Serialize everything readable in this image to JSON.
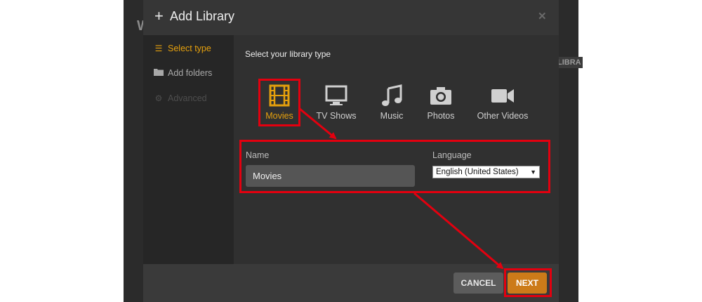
{
  "background": {
    "partial_letter": "W",
    "partial_label": "LIBRA"
  },
  "dialog": {
    "title": "Add Library",
    "plus_icon": "plus-icon",
    "close_icon": "close-icon"
  },
  "sidebar": {
    "items": [
      {
        "label": "Select type",
        "icon": "list-icon",
        "state": "active"
      },
      {
        "label": "Add folders",
        "icon": "folder-icon",
        "state": "normal"
      },
      {
        "label": "Advanced",
        "icon": "gear-icon",
        "state": "disabled"
      }
    ]
  },
  "main": {
    "prompt": "Select your library type",
    "types": [
      {
        "label": "Movies",
        "icon": "film-icon",
        "selected": true
      },
      {
        "label": "TV Shows",
        "icon": "tv-icon",
        "selected": false
      },
      {
        "label": "Music",
        "icon": "music-icon",
        "selected": false
      },
      {
        "label": "Photos",
        "icon": "camera-icon",
        "selected": false
      },
      {
        "label": "Other Videos",
        "icon": "video-camera-icon",
        "selected": false
      }
    ],
    "name_label": "Name",
    "name_value": "Movies",
    "language_label": "Language",
    "language_value": "English (United States)"
  },
  "footer": {
    "cancel_label": "CANCEL",
    "next_label": "NEXT"
  },
  "colors": {
    "accent": "#e5a00d",
    "next_button": "#cc7b19",
    "annotation_red": "#e3000f"
  }
}
